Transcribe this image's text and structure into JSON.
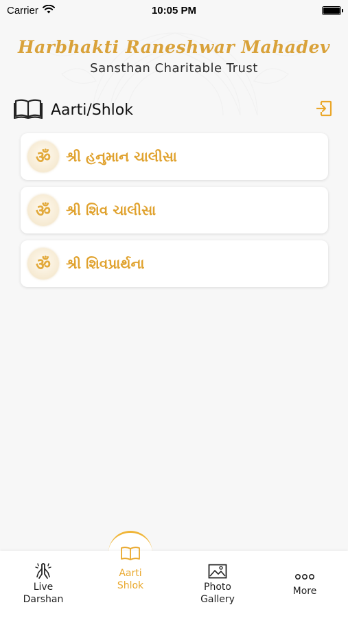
{
  "status_bar": {
    "carrier": "Carrier",
    "time": "10:05 PM"
  },
  "header": {
    "title": "Harbhakti Raneshwar Mahadev",
    "subtitle": "Sansthan Charitable Trust"
  },
  "section": {
    "title": "Aarti/Shlok"
  },
  "items": [
    {
      "badge": "ॐ",
      "label": "શ્રી હનુમાન ચાલીસા"
    },
    {
      "badge": "ॐ",
      "label": "શ્રી શિવ ચાલીસા"
    },
    {
      "badge": "ॐ",
      "label": "શ્રી શિવપ્રાર્થના"
    }
  ],
  "tabs": [
    {
      "label_line1": "Live",
      "label_line2": "Darshan",
      "icon": "praying-hands-icon",
      "active": false
    },
    {
      "label_line1": "Aarti",
      "label_line2": "Shlok",
      "icon": "book-icon",
      "active": true
    },
    {
      "label_line1": "Photo",
      "label_line2": "Gallery",
      "icon": "image-icon",
      "active": false
    },
    {
      "label_line1": "More",
      "label_line2": "",
      "icon": "more-dots-icon",
      "active": false
    }
  ],
  "colors": {
    "accent": "#e0a22e",
    "title_gold": "#d9a23a",
    "background": "#f7f7f7"
  }
}
